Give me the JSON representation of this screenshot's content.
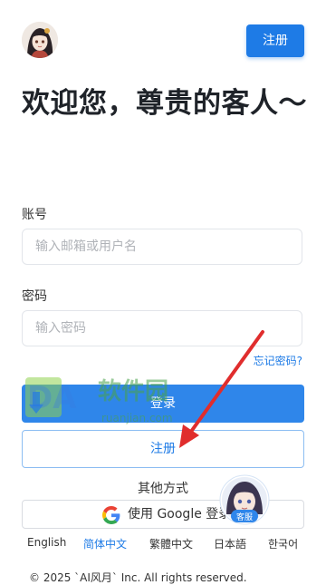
{
  "header": {
    "register_label": "注册"
  },
  "welcome": {
    "title": "欢迎您，尊贵的客人～"
  },
  "form": {
    "account_label": "账号",
    "account_placeholder": "输入邮箱或用户名",
    "password_label": "密码",
    "password_placeholder": "输入密码",
    "forgot_label": "忘记密码?",
    "login_label": "登录",
    "register_label": "注册"
  },
  "other": {
    "title": "其他方式",
    "google_label": "使用 Google 登录"
  },
  "languages": [
    {
      "label": "English",
      "active": false
    },
    {
      "label": "简体中文",
      "active": true
    },
    {
      "label": "繁體中文",
      "active": false
    },
    {
      "label": "日本語",
      "active": false
    },
    {
      "label": "한국어",
      "active": false
    }
  ],
  "footer": {
    "copyright": "© 2025 `AI风月` Inc. All rights reserved."
  },
  "customer_service": {
    "label": "客服"
  },
  "watermark": {
    "logo_text": "DA",
    "brand_text": "软件园",
    "domain_text": "ruanjian.com"
  },
  "colors": {
    "primary": "#1e7be6",
    "login_button": "#2f86ea",
    "annotation_arrow": "#e02d2d"
  },
  "icons": {
    "avatar": "anime-avatar",
    "google": "google-g-icon",
    "customer_service": "customer-service-avatar-icon"
  }
}
